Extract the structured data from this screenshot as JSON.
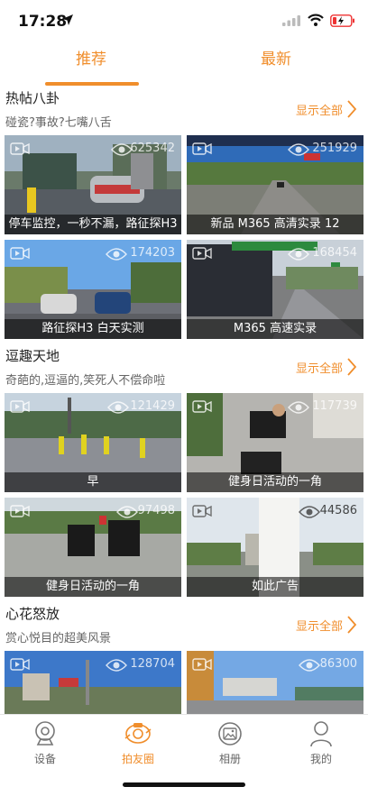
{
  "status_bar": {
    "time": "17:28"
  },
  "top_tabs": [
    {
      "label": "推荐",
      "active": true
    },
    {
      "label": "最新",
      "active": false
    }
  ],
  "accent_color": "#f08e2c",
  "sections": [
    {
      "title": "热帖八卦",
      "subtitle": "碰瓷?事故?七嘴八舌",
      "show_all": "显示全部",
      "cards": [
        {
          "caption": "停车监控，一秒不漏，路征探H3",
          "views": "625342"
        },
        {
          "caption": "新品 M365 高清实录 12",
          "views": "251929"
        },
        {
          "caption": "路征探H3 白天实测",
          "views": "174203"
        },
        {
          "caption": "M365 高速实录",
          "views": "168454"
        }
      ]
    },
    {
      "title": "逗趣天地",
      "subtitle": "奇葩的,逗逼的,笑死人不偿命啦",
      "show_all": "显示全部",
      "cards": [
        {
          "caption": "早",
          "views": "121429"
        },
        {
          "caption": "健身日活动的一角",
          "views": "117739"
        },
        {
          "caption": "健身日活动的一角",
          "views": "97498"
        },
        {
          "caption": "如此广告",
          "views": "44586"
        }
      ]
    },
    {
      "title": "心花怒放",
      "subtitle": "赏心悦目的超美风景",
      "show_all": "显示全部",
      "cards": [
        {
          "caption": "",
          "views": "128704"
        },
        {
          "caption": "",
          "views": "86300"
        }
      ]
    }
  ],
  "bottom_nav": [
    {
      "label": "设备",
      "icon": "camera-icon",
      "active": false
    },
    {
      "label": "拍友圈",
      "icon": "friends-circle-icon",
      "active": true
    },
    {
      "label": "相册",
      "icon": "album-icon",
      "active": false
    },
    {
      "label": "我的",
      "icon": "person-icon",
      "active": false
    }
  ]
}
